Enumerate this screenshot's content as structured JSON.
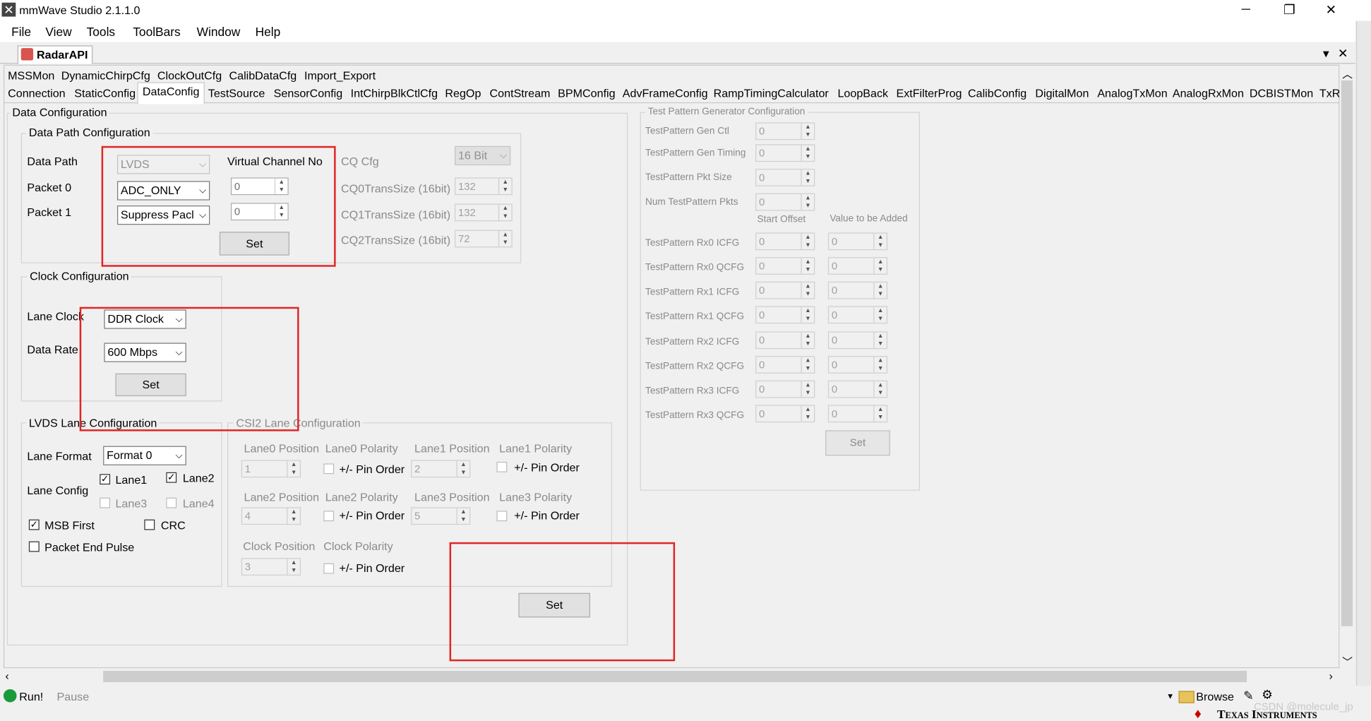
{
  "window": {
    "title": "mmWave Studio 2.1.1.0",
    "min": "─",
    "restore": "❐",
    "close": "✕"
  },
  "menu": [
    "File",
    "View",
    "Tools",
    "ToolBars",
    "Window",
    "Help"
  ],
  "doc_tab": {
    "label": "RadarAPI",
    "dropdown": "▾",
    "close": "✕"
  },
  "tabs_row1": [
    "MSSMon",
    "DynamicChirpCfg",
    "ClockOutCfg",
    "CalibDataCfg",
    "Import_Export"
  ],
  "tabs_row2": [
    "Connection",
    "StaticConfig",
    "DataConfig",
    "TestSource",
    "SensorConfig",
    "IntChirpBlkCtlCfg",
    "RegOp",
    "ContStream",
    "BPMConfig",
    "AdvFrameConfig",
    "RampTimingCalculator",
    "LoopBack",
    "ExtFilterProg",
    "CalibConfig",
    "DigitalMon",
    "AnalogTxMon",
    "AnalogRxMon",
    "DCBISTMon",
    "TxR"
  ],
  "data_config": {
    "title": "Data Configuration",
    "path": {
      "title": "Data Path Configuration",
      "data_path_label": "Data Path",
      "data_path_value": "LVDS",
      "vc_label": "Virtual Channel No",
      "packet0_label": "Packet 0",
      "packet0_value": "ADC_ONLY",
      "packet0_vc": "0",
      "packet1_label": "Packet 1",
      "packet1_value": "Suppress Pacl",
      "packet1_vc": "0",
      "set": "Set",
      "cq_cfg_label": "CQ Cfg",
      "cq_cfg_value": "16 Bit",
      "cq0_label": "CQ0TransSize (16bit)",
      "cq0_value": "132",
      "cq1_label": "CQ1TransSize (16bit)",
      "cq1_value": "132",
      "cq2_label": "CQ2TransSize (16bit)",
      "cq2_value": "72"
    },
    "clock": {
      "title": "Clock Configuration",
      "lane_clock_label": "Lane Clock",
      "lane_clock_value": "DDR Clock",
      "data_rate_label": "Data Rate",
      "data_rate_value": "600 Mbps",
      "set": "Set"
    },
    "lvds": {
      "title": "LVDS Lane Configuration",
      "format_label": "Lane Format",
      "format_value": "Format 0",
      "config_label": "Lane Config",
      "lane1": "Lane1",
      "lane2": "Lane2",
      "lane3": "Lane3",
      "lane4": "Lane4",
      "msb": "MSB First",
      "crc": "CRC",
      "packet_end": "Packet End Pulse",
      "lane1_checked": true,
      "lane2_checked": true,
      "lane3_checked": false,
      "lane4_checked": false,
      "msb_checked": true,
      "crc_checked": false,
      "packet_end_checked": false
    },
    "csi2": {
      "title": "CSI2 Lane Configuration",
      "lane0_pos": "Lane0 Position",
      "lane0_pol": "Lane0 Polarity",
      "lane1_pos": "Lane1 Position",
      "lane1_pol": "Lane1 Polarity",
      "lane2_pos": "Lane2 Position",
      "lane2_pol": "Lane2 Polarity",
      "lane3_pos": "Lane3 Position",
      "lane3_pol": "Lane3 Polarity",
      "clock_pos": "Clock Position",
      "clock_pol": "Clock Polarity",
      "pin_order": "+/- Pin Order",
      "lane0_val": "1",
      "lane1_val": "2",
      "lane2_val": "4",
      "lane3_val": "5",
      "clock_val": "3"
    },
    "bottom_set": "Set"
  },
  "test_pattern": {
    "title": "Test Pattern Generator Configuration",
    "rows_top": [
      {
        "label": "TestPattern Gen Ctl",
        "value": "0"
      },
      {
        "label": "TestPattern Gen Timing",
        "value": "0"
      },
      {
        "label": "TestPattern Pkt Size",
        "value": "0"
      },
      {
        "label": "Num TestPattern Pkts",
        "value": "0"
      }
    ],
    "col_start": "Start Offset",
    "col_add": "Value to be Added",
    "rows": [
      {
        "label": "TestPattern Rx0 ICFG",
        "start": "0",
        "add": "0"
      },
      {
        "label": "TestPattern Rx0 QCFG",
        "start": "0",
        "add": "0"
      },
      {
        "label": "TestPattern Rx1 ICFG",
        "start": "0",
        "add": "0"
      },
      {
        "label": "TestPattern Rx1 QCFG",
        "start": "0",
        "add": "0"
      },
      {
        "label": "TestPattern Rx2 ICFG",
        "start": "0",
        "add": "0"
      },
      {
        "label": "TestPattern Rx2 QCFG",
        "start": "0",
        "add": "0"
      },
      {
        "label": "TestPattern Rx3 ICFG",
        "start": "0",
        "add": "0"
      },
      {
        "label": "TestPattern Rx3 QCFG",
        "start": "0",
        "add": "0"
      }
    ],
    "set": "Set"
  },
  "status": {
    "run": "Run!",
    "pause": "Pause",
    "browse": "Browse",
    "watermark": "CSDN @molecule_jp",
    "ti": "Texas Instruments"
  }
}
